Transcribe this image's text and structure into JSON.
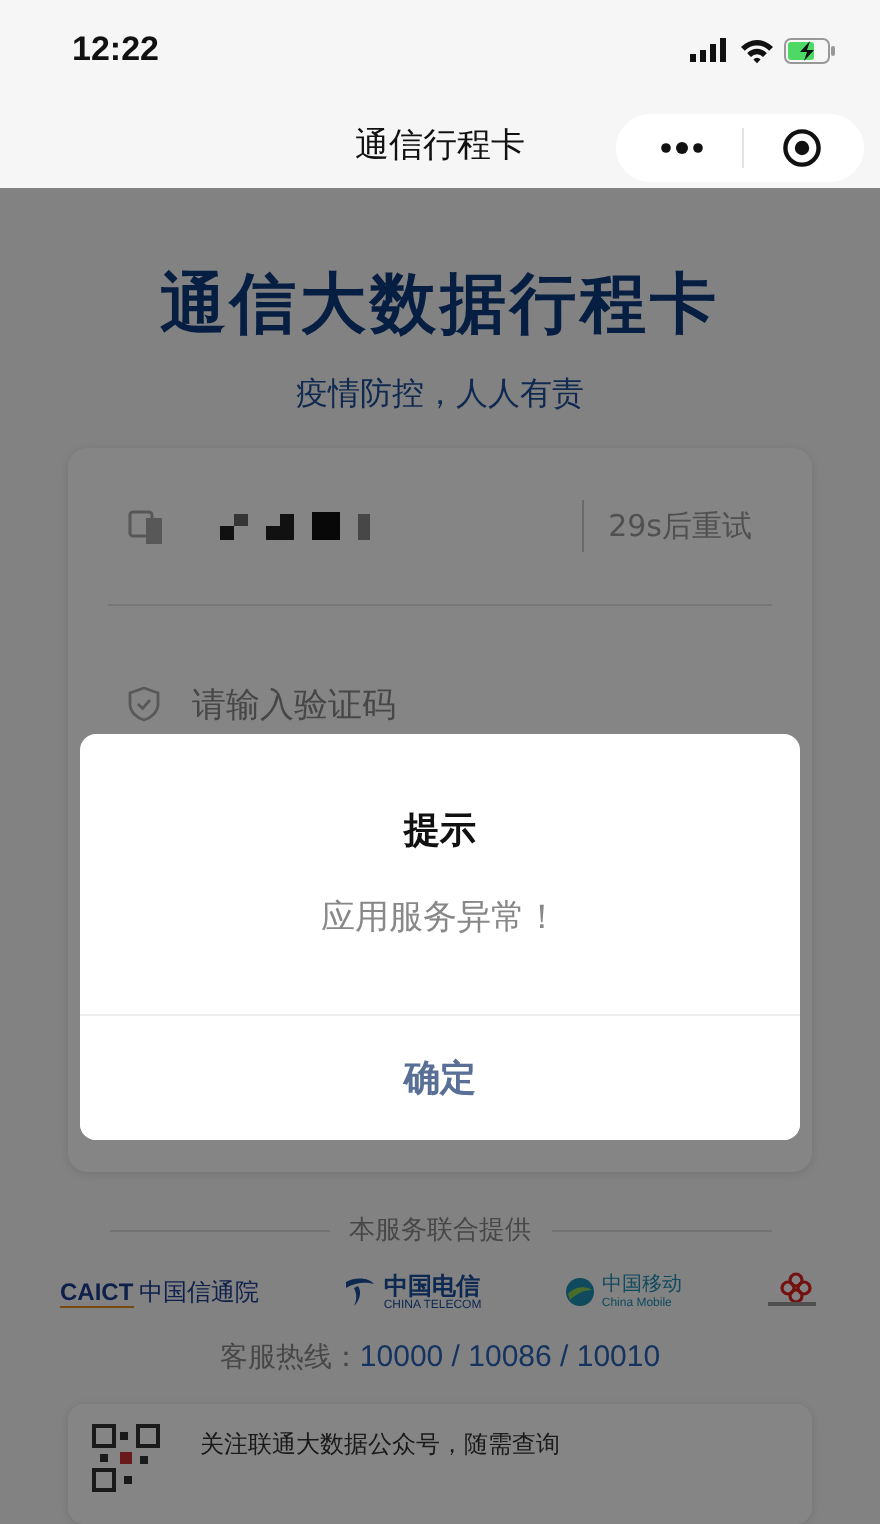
{
  "status_bar": {
    "time": "12:22"
  },
  "nav_bar": {
    "title": "通信行程卡"
  },
  "header": {
    "title": "通信大数据行程卡",
    "subtitle": "疫情防控，人人有责"
  },
  "form": {
    "retry_button": "29s后重试",
    "code_field": {
      "placeholder": "请输入验证码"
    }
  },
  "footer": {
    "providers_label": "本服务联合提供",
    "providers": [
      {
        "kind": "caict",
        "mark": "CAICT",
        "name": "中国信通院"
      },
      {
        "kind": "telecom",
        "name": "中国电信",
        "subtitle": "CHINA TELECOM"
      },
      {
        "kind": "mobile",
        "name": "中国移动",
        "subtitle": "China Mobile"
      },
      {
        "kind": "unicom"
      }
    ],
    "hotline_label": "客服热线：",
    "hotline_numbers": "10000 / 10086 / 10010",
    "follow_text": "关注联通大数据公众号，随需查询"
  },
  "dialog": {
    "title": "提示",
    "message": "应用服务异常！",
    "button": "确定"
  }
}
